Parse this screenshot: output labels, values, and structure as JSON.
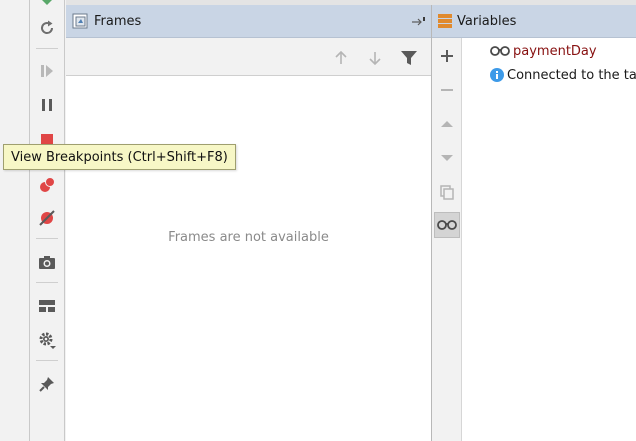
{
  "frames_panel": {
    "title": "Frames",
    "empty_message": "Frames are not available",
    "toolbar": {
      "up_icon": "arrow-up-icon",
      "down_icon": "arrow-down-icon",
      "filter_icon": "filter-icon"
    }
  },
  "variables_panel": {
    "title": "Variables",
    "items": [
      {
        "icon": "watch-glasses-icon",
        "name": "paymentDay"
      },
      {
        "icon": "info-icon",
        "text": "Connected to the ta"
      }
    ],
    "toolbar": [
      "plus-icon",
      "minus-icon",
      "up-icon",
      "down-icon",
      "copy-icon",
      "glasses-icon"
    ]
  },
  "debug_toolbar": [
    "rerun-icon",
    "resume-icon",
    "pause-icon",
    "stop-icon",
    "view-breakpoints-icon",
    "mute-breakpoints-icon",
    "camera-icon",
    "layout-icon",
    "settings-icon",
    "pin-icon"
  ],
  "tooltip": {
    "text": "View Breakpoints (Ctrl+Shift+F8)"
  },
  "colors": {
    "header_bg": "#c9d5e5",
    "variable_name": "#871010",
    "info_blue": "#3d9ae8",
    "breakpoint_red": "#e04646",
    "tooltip_bg": "#f7f7c6"
  }
}
